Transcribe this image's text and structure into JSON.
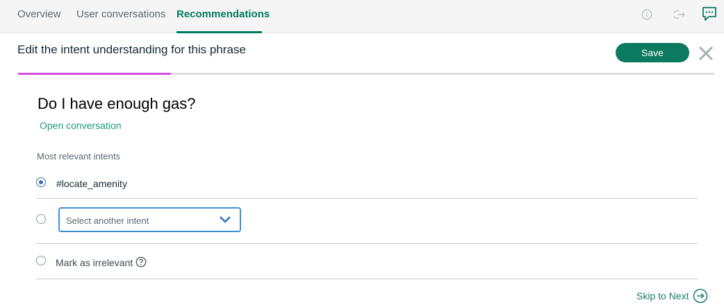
{
  "tabs": [
    {
      "label": "Overview"
    },
    {
      "label": "User conversations"
    },
    {
      "label": "Recommendations",
      "active": true
    }
  ],
  "header_icons": [
    "info-icon",
    "logout-icon",
    "chat-icon"
  ],
  "panel": {
    "title": "Edit the intent understanding for this phrase",
    "save_label": "Save",
    "progress": 0.22
  },
  "phrase": {
    "text": "Do I have enough gas?",
    "open_link": "Open conversation"
  },
  "intents": {
    "section_label": "Most relevant intents",
    "selected": "#locate_amenity",
    "select_placeholder": "Select another intent",
    "irrelevant_label": "Mark as irrelevant"
  },
  "footer": {
    "skip_label": "Skip to Next"
  },
  "colors": {
    "accent_green": "#007a5c",
    "save_bg": "#0b7a5e",
    "progress_magenta": "#d84bdc",
    "select_border": "#3d8fd8",
    "radio_blue": "#3d70b2"
  }
}
